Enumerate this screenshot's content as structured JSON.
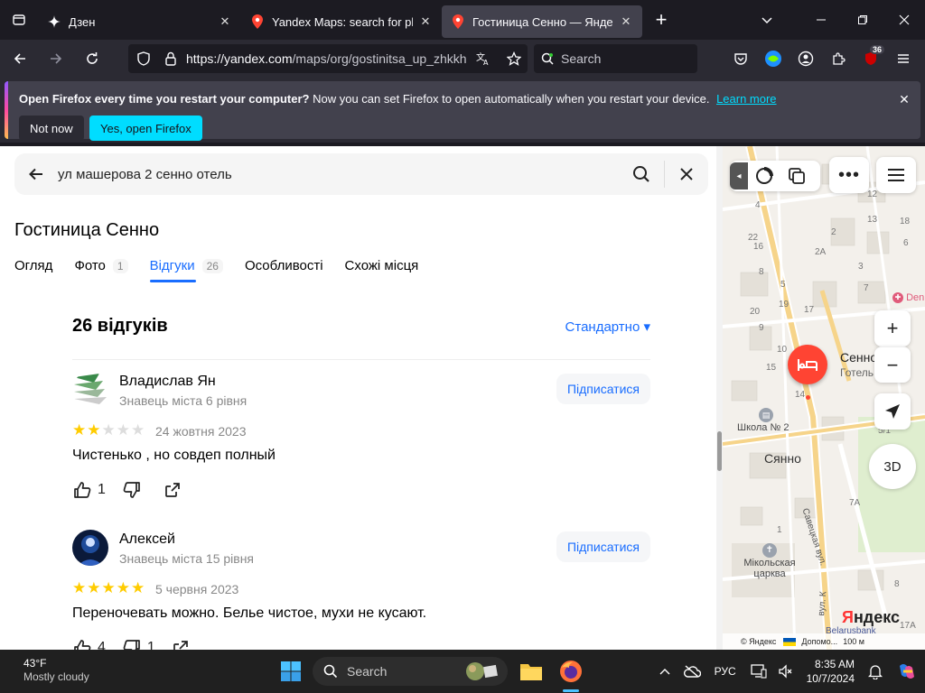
{
  "browser": {
    "tabs": [
      {
        "title": "Дзен",
        "active": false
      },
      {
        "title": "Yandex Maps: search for places",
        "active": false
      },
      {
        "title": "Гостиница Сенно — Яндекс Карты",
        "active": true
      }
    ],
    "url": {
      "host": "https://yandex.com",
      "path": "/maps/org/gostinitsa_up_zhkkh/"
    },
    "search_placeholder": "Search",
    "extension_badge": "36"
  },
  "notification": {
    "title": "Open Firefox every time you restart your computer?",
    "message": "Now you can set Firefox to open automatically when you restart your device.",
    "learn_more": "Learn more",
    "not_now": "Not now",
    "yes_open": "Yes, open Firefox"
  },
  "search": {
    "query": "ул машерова 2 сенно отель"
  },
  "org": {
    "title": "Гостиница Сенно",
    "tabs": [
      {
        "label": "Огляд",
        "count": ""
      },
      {
        "label": "Фото",
        "count": "1"
      },
      {
        "label": "Відгуки",
        "count": "26",
        "active": true
      },
      {
        "label": "Особливості",
        "count": ""
      },
      {
        "label": "Схожі місця",
        "count": ""
      }
    ]
  },
  "reviews": {
    "count_label": "26 відгуків",
    "sort_label": "Стандартно ▾",
    "subscribe_label": "Підписатися",
    "items": [
      {
        "name": "Владислав Ян",
        "level": "Знавець міста 6 рівня",
        "rating": 2,
        "date": "24 жовтня 2023",
        "text": "Чистенько , но совдеп полный",
        "likes": "1",
        "dislikes": ""
      },
      {
        "name": "Алексей",
        "level": "Знавець міста 15 рівня",
        "rating": 5,
        "date": "5 червня 2023",
        "text": "Переночевать можно. Белье чистое, мухи не кусают.",
        "likes": "4",
        "dislikes": "1"
      }
    ]
  },
  "map": {
    "pin_name": "Сенно",
    "pin_category": "Готель",
    "city_label": "Сянно",
    "school_label": "Школа № 2",
    "church_label": "Мікольская царква",
    "street1": "Савецкая вул.",
    "street2": "вул. К",
    "dent_label": "Den",
    "zoom_in": "+",
    "zoom_out": "−",
    "three_d": "3D",
    "logo_y": "Я",
    "logo_rest": "ндекс",
    "belarusbank": "Belarusbank",
    "footer_copyright": "© Яндекс",
    "footer_more": "Допомо...",
    "footer_scale": "100 м",
    "house_numbers": [
      "12",
      "2",
      "2A",
      "3",
      "4",
      "5",
      "7",
      "8",
      "9",
      "10",
      "13",
      "14",
      "15",
      "16",
      "17",
      "18",
      "19",
      "20",
      "22",
      "1",
      "6",
      "7A",
      "5/1",
      "17A",
      "8"
    ]
  },
  "taskbar": {
    "temperature": "43°F",
    "condition": "Mostly cloudy",
    "search_label": "Search",
    "language": "РУС",
    "time": "8:35 AM",
    "date": "10/7/2024"
  }
}
